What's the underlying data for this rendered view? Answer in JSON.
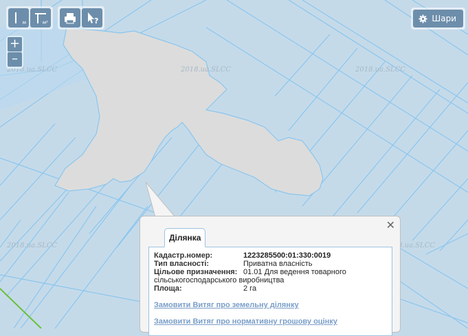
{
  "watermark": "2018.ua.SLCC",
  "toolbar": {
    "measure_sub": "м",
    "area_sub": "м²"
  },
  "zoom": {
    "in_label": "+",
    "out_label": "–"
  },
  "layers_button": {
    "label": "Шари",
    "icon": "gear-icon"
  },
  "colors": {
    "parcel_fill": "#c5dae9",
    "parcel_border": "#8ac6ee",
    "selected_fill": "#dcdcdc",
    "accent": "#6d8eab",
    "link": "#7a9ec8"
  },
  "popup": {
    "tab_label": "Ділянка",
    "fields": [
      {
        "label": "Кадастр.номер:",
        "value": "1223285500:01:330:0019"
      },
      {
        "label": "Тип власності:",
        "value": "Приватна власність"
      },
      {
        "label": "Цільове призначення:",
        "value": "01.01 Для ведення товарного сільськогосподарського виробництва"
      },
      {
        "label": "Площа:",
        "value": "2 га"
      }
    ],
    "links": [
      "Замовити Витяг про земельну ділянку",
      "Замовити Витяг про нормативну грошову оцінку"
    ]
  }
}
